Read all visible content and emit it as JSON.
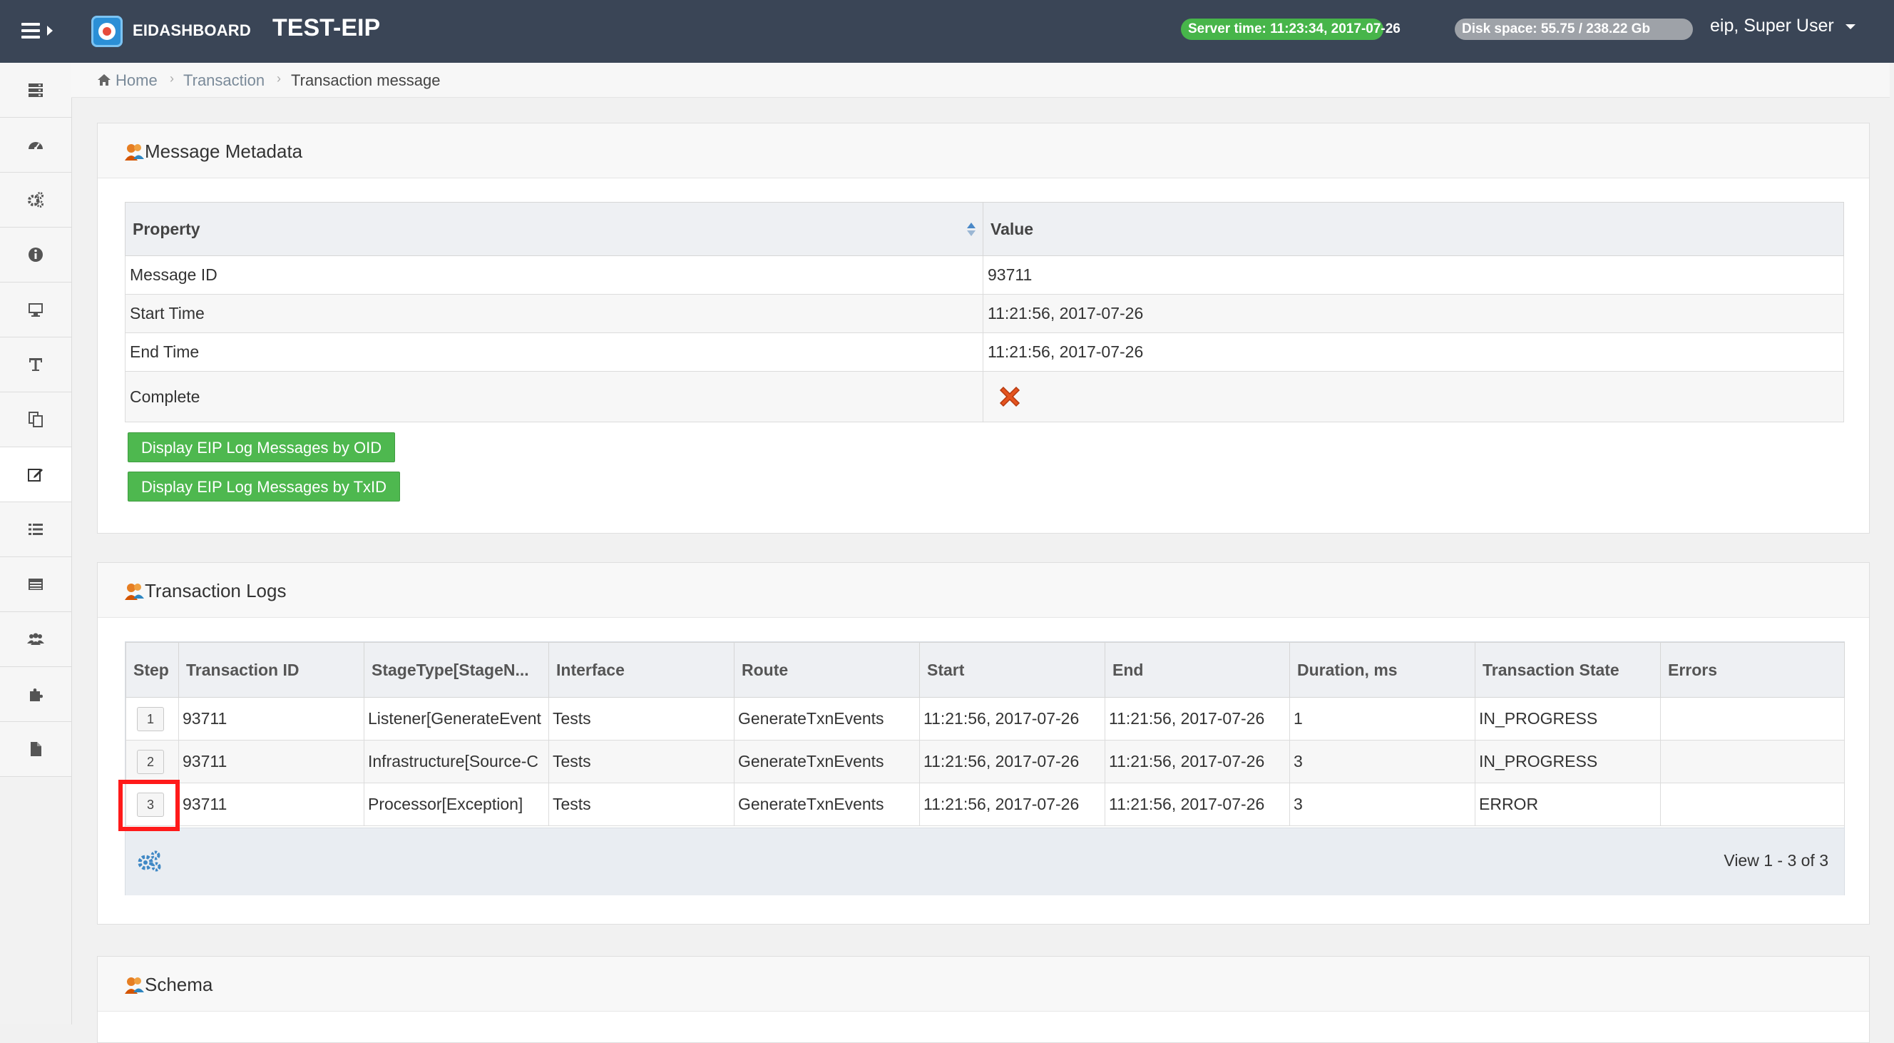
{
  "topbar": {
    "brand": "EIDASHBOARD",
    "env_title": "TEST-EIP",
    "server_time": "Server time: 11:23:34, 2017-07-26",
    "disk_space": "Disk space: 55.75 / 238.22 Gb",
    "user": "eip, Super User"
  },
  "sidebar": {
    "items": [
      {
        "icon": "server-icon"
      },
      {
        "icon": "dashboard-icon"
      },
      {
        "icon": "gears-icon"
      },
      {
        "icon": "info-icon"
      },
      {
        "icon": "monitor-icon"
      },
      {
        "icon": "text-icon"
      },
      {
        "icon": "copy-icon"
      },
      {
        "icon": "edit-icon",
        "active": true
      },
      {
        "icon": "list-icon"
      },
      {
        "icon": "table-icon"
      },
      {
        "icon": "users-icon"
      },
      {
        "icon": "puzzle-icon"
      },
      {
        "icon": "file-icon"
      }
    ]
  },
  "breadcrumb": {
    "home": "Home",
    "transaction": "Transaction",
    "current": "Transaction message"
  },
  "metadata": {
    "title": "Message Metadata",
    "col_property": "Property",
    "col_value": "Value",
    "rows": [
      {
        "property": "Message ID",
        "value": "93711"
      },
      {
        "property": "Start Time",
        "value": "11:21:56, 2017-07-26"
      },
      {
        "property": "End Time",
        "value": "11:21:56, 2017-07-26"
      },
      {
        "property": "Complete",
        "value_icon": "red-x-icon"
      }
    ],
    "btn_oid": "Display EIP Log Messages by OID",
    "btn_txid": "Display EIP Log Messages by TxID"
  },
  "transaction_logs": {
    "title": "Transaction Logs",
    "headers": [
      "Step",
      "Transaction ID",
      "StageType[StageN...",
      "Interface",
      "Route",
      "Start",
      "End",
      "Duration, ms",
      "Transaction State",
      "Errors"
    ],
    "rows": [
      {
        "step": "1",
        "txid": "93711",
        "stage": "Listener[GenerateEvent",
        "interface": "Tests",
        "route": "GenerateTxnEvents",
        "start": "11:21:56, 2017-07-26",
        "end": "11:21:56, 2017-07-26",
        "duration": "1",
        "state": "IN_PROGRESS",
        "errors": ""
      },
      {
        "step": "2",
        "txid": "93711",
        "stage": "Infrastructure[Source-C",
        "interface": "Tests",
        "route": "GenerateTxnEvents",
        "start": "11:21:56, 2017-07-26",
        "end": "11:21:56, 2017-07-26",
        "duration": "3",
        "state": "IN_PROGRESS",
        "errors": ""
      },
      {
        "step": "3",
        "txid": "93711",
        "stage": "Processor[Exception]",
        "interface": "Tests",
        "route": "GenerateTxnEvents",
        "start": "11:21:56, 2017-07-26",
        "end": "11:21:56, 2017-07-26",
        "duration": "3",
        "state": "ERROR",
        "errors": ""
      }
    ],
    "view_info": "View 1 - 3 of 3"
  },
  "schema": {
    "title": "Schema"
  },
  "colors": {
    "topbar": "#3a4556",
    "server_pill": "#47b54a",
    "disk_pill": "#9ea2a8",
    "button_green": "#4eb84f",
    "highlight": "#ff1a1a"
  }
}
